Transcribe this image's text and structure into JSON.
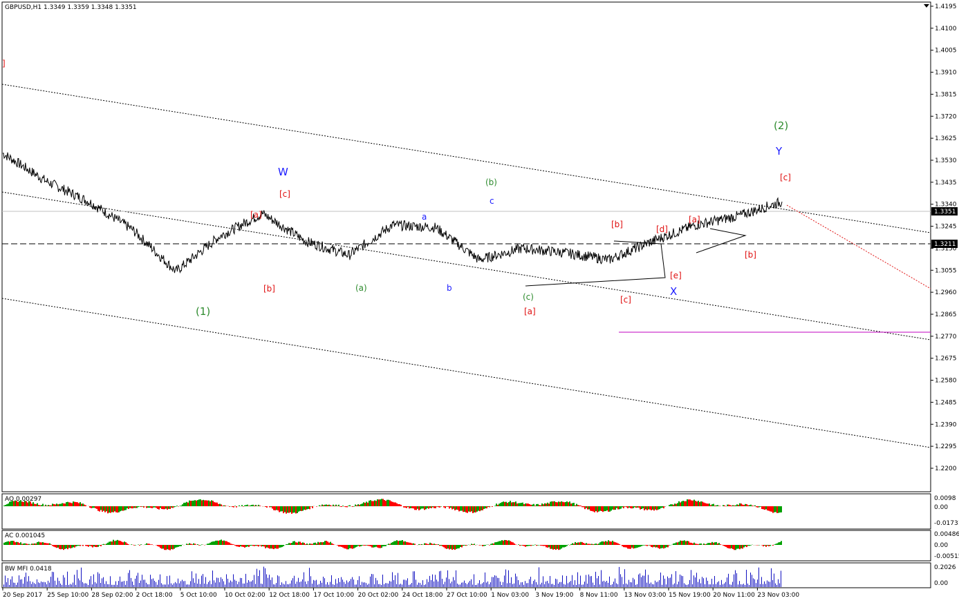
{
  "chart_header": "GBPUSD,H1  1.3349 1.3359 1.3348 1.3351",
  "main_price_labels": [
    "1.4195",
    "1.4100",
    "1.4005",
    "1.3910",
    "1.3815",
    "1.3720",
    "1.3625",
    "1.3530",
    "1.3435",
    "1.3340",
    "1.3245",
    "1.3150",
    "1.3055",
    "1.2960",
    "1.2865",
    "1.2770",
    "1.2675",
    "1.2580",
    "1.2485",
    "1.2390",
    "1.2295",
    "1.2200"
  ],
  "current_price_tag": "1.3351",
  "level_price_tag": "1.3211",
  "ao": {
    "label": "AO 0.00297",
    "scale": [
      "0.0098",
      "0.00",
      "-0.01731"
    ]
  },
  "ac": {
    "label": "AC 0.001045",
    "scale": [
      "0.004861",
      "0.00",
      "-0.00515"
    ]
  },
  "mfi": {
    "label": "BW MFI 0.0418",
    "scale": [
      "0.2026",
      "0.00"
    ]
  },
  "time_labels": [
    "20 Sep 2017",
    "25 Sep 10:00",
    "28 Sep 02:00",
    "2 Oct 18:00",
    "5 Oct 10:00",
    "10 Oct 02:00",
    "12 Oct 18:00",
    "17 Oct 10:00",
    "20 Oct 02:00",
    "24 Oct 18:00",
    "27 Oct 10:00",
    "1 Nov 03:00",
    "3 Nov 19:00",
    "8 Nov 11:00",
    "13 Nov 03:00",
    "15 Nov 19:00",
    "20 Nov 11:00",
    "23 Nov 03:00"
  ],
  "wave_labels": {
    "w1": "(1)",
    "w2": "(2)",
    "W": "W",
    "X": "X",
    "Y": "Y",
    "a1": "[a]",
    "b1": "[b]",
    "c1": "[c]",
    "sa": "(a)",
    "sb": "(b)",
    "sc": "(c)",
    "la": "a",
    "lb": "b",
    "lc": "c",
    "a2": "[a]",
    "b2": "[b]",
    "c2": "[c]",
    "d2": "[d]",
    "e2": "[e]",
    "a3": "[a]",
    "b3": "[b]",
    "c3": "[c]",
    "edge": "]"
  },
  "colors": {
    "green": "#2e8b2e",
    "blue": "#1a1aff",
    "red": "#e01010",
    "bull": "#00a000",
    "bear": "#ff0000",
    "mfi": "#1010c0",
    "magenta": "#c000c0"
  },
  "chart_data": {
    "type": "line",
    "symbol": "GBPUSD",
    "timeframe": "H1",
    "x": [
      "20 Sep 2017",
      "25 Sep 10:00",
      "28 Sep 02:00",
      "2 Oct 18:00",
      "5 Oct 10:00",
      "10 Oct 02:00",
      "12 Oct 18:00",
      "17 Oct 10:00",
      "20 Oct 02:00",
      "24 Oct 18:00",
      "27 Oct 10:00",
      "1 Nov 03:00",
      "3 Nov 19:00",
      "8 Nov 11:00",
      "13 Nov 03:00",
      "15 Nov 19:00",
      "20 Nov 11:00",
      "23 Nov 03:00",
      "24 Nov"
    ],
    "y": [
      1.356,
      1.344,
      1.335,
      1.323,
      1.305,
      1.32,
      1.33,
      1.318,
      1.312,
      1.325,
      1.324,
      1.31,
      1.315,
      1.313,
      1.31,
      1.318,
      1.325,
      1.329,
      1.3351
    ],
    "ylim": [
      1.22,
      1.4195
    ],
    "current_price": 1.3351,
    "horizontal_level": 1.3211,
    "support_level": 1.285
  }
}
